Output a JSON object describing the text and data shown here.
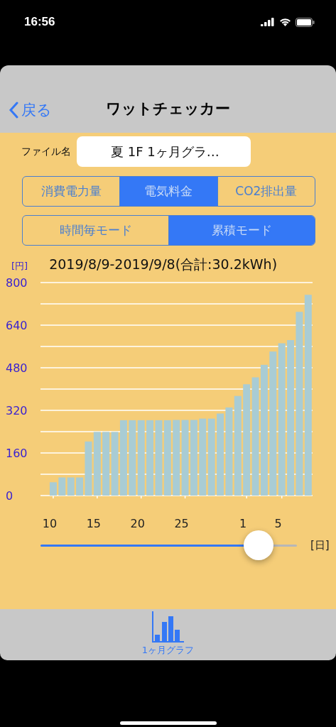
{
  "status_bar": {
    "time": "16:56"
  },
  "nav": {
    "back": "戻る",
    "title": "ワットチェッカー"
  },
  "file": {
    "label": "ファイル名",
    "value": "夏  1F  1ヶ月グラ…"
  },
  "metric_tabs": [
    {
      "label": "消費電力量",
      "selected": false
    },
    {
      "label": "電気料金",
      "selected": true
    },
    {
      "label": "CO2排出量",
      "selected": false
    }
  ],
  "mode_tabs": [
    {
      "label": "時間毎モード",
      "selected": false
    },
    {
      "label": "累積モード",
      "selected": true
    }
  ],
  "chart": {
    "title": "2019/8/9-2019/9/8(合計:30.2kWh)",
    "unit": "[円]",
    "chart_data": {
      "type": "bar",
      "grid": true,
      "ylim": [
        0,
        800
      ],
      "yticks": [
        0,
        160,
        320,
        480,
        640,
        800
      ],
      "categories": [
        "10",
        null,
        null,
        null,
        null,
        "15",
        null,
        null,
        null,
        null,
        "20",
        null,
        null,
        null,
        null,
        "25",
        null,
        null,
        null,
        null,
        null,
        null,
        "1",
        null,
        null,
        null,
        "5",
        null,
        null,
        null
      ],
      "values": [
        50,
        68,
        68,
        68,
        203,
        239,
        239,
        239,
        283,
        283,
        283,
        283,
        283,
        283,
        284,
        284,
        284,
        289,
        289,
        308,
        331,
        374,
        418,
        444,
        491,
        541,
        572,
        584,
        690,
        754
      ]
    }
  },
  "slider": {
    "level": 0.85,
    "unit": "[日]"
  },
  "tab_bar": [
    {
      "label": "1ヶ月グラフ",
      "selected": true
    }
  ]
}
